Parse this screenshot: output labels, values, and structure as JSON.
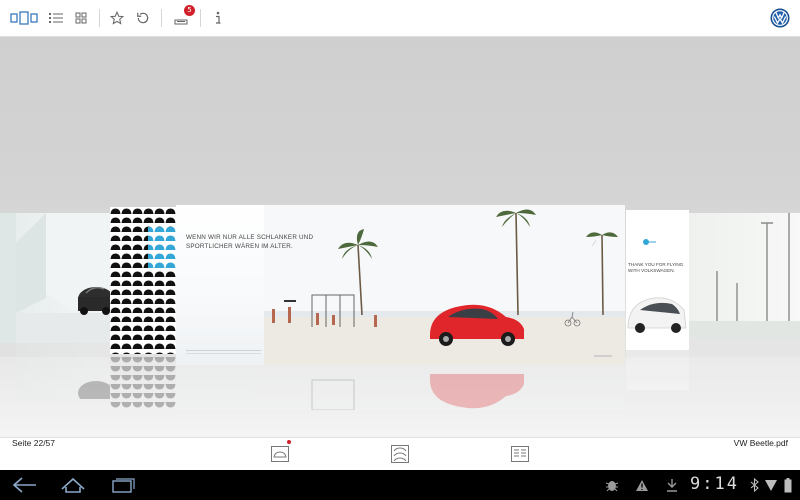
{
  "toolbar": {
    "buttons": [
      {
        "name": "page-view-icon",
        "label": ""
      },
      {
        "name": "list-icon",
        "label": ""
      },
      {
        "name": "grid-icon",
        "label": ""
      },
      {
        "name": "star-icon",
        "label": ""
      },
      {
        "name": "refresh-icon",
        "label": ""
      },
      {
        "name": "downloads-icon",
        "label": ""
      },
      {
        "name": "info-icon",
        "label": ""
      }
    ],
    "downloads_badge": "5",
    "brand_icon": "vw-logo-icon",
    "accent": "#2b6fb8"
  },
  "spread": {
    "headline": "WENN WIR NUR ALLE SCHLANKER UND SPORTLICHER WÄREN IM ALTER.",
    "car_color": "#e0262a"
  },
  "right_page": {
    "text": "THANK YOU FOR FLYING WITH VOLKSWAGEN."
  },
  "status": {
    "page_info": "Seite 22/57",
    "file_name": "VW Beetle.pdf"
  },
  "view_modes": [
    {
      "name": "car-view-icon",
      "active": true
    },
    {
      "name": "cars-list-icon",
      "active": false
    },
    {
      "name": "text-view-icon",
      "active": false
    }
  ],
  "system_bar": {
    "time": "9:14",
    "icons": [
      "back-icon",
      "home-icon",
      "recent-apps-icon",
      "debug-icon",
      "warning-icon",
      "download-status-icon",
      "bluetooth-icon",
      "wifi-icon",
      "battery-icon"
    ]
  }
}
